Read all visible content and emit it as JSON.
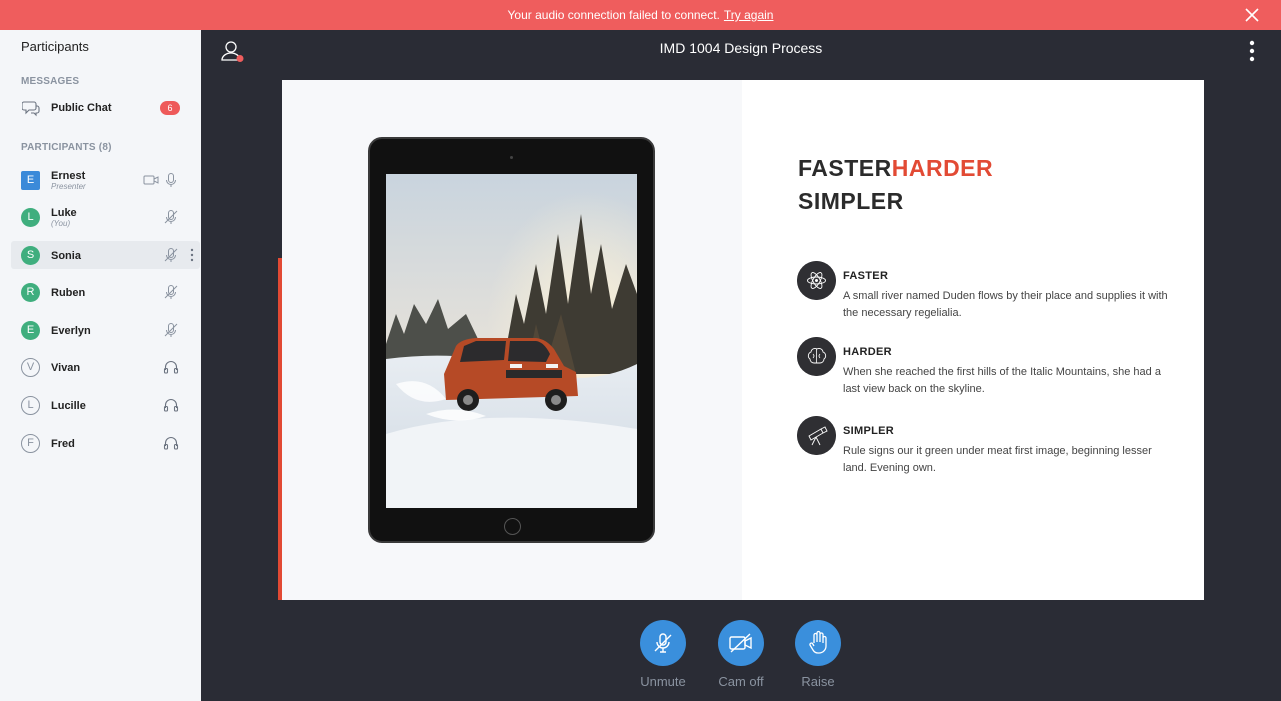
{
  "alert": {
    "message": "Your audio connection failed to connect.",
    "link": "Try again"
  },
  "sidebar": {
    "title": "Participants",
    "messages_label": "MESSAGES",
    "public_chat": {
      "label": "Public Chat",
      "unread": "6"
    },
    "participants_label": "PARTICIPANTS (8)",
    "participants": [
      {
        "initial": "E",
        "name": "Ernest",
        "role": "Presenter",
        "audio": "mic",
        "video": true
      },
      {
        "initial": "L",
        "name": "Luke",
        "role": "(You)",
        "audio": "muted"
      },
      {
        "initial": "S",
        "name": "Sonia",
        "role": "",
        "audio": "muted"
      },
      {
        "initial": "R",
        "name": "Ruben",
        "role": "",
        "audio": "muted"
      },
      {
        "initial": "E",
        "name": "Everlyn",
        "role": "",
        "audio": "muted"
      },
      {
        "initial": "V",
        "name": "Vivan",
        "role": "",
        "audio": "listen-only"
      },
      {
        "initial": "L",
        "name": "Lucille",
        "role": "",
        "audio": "listen-only"
      },
      {
        "initial": "F",
        "name": "Fred",
        "role": "",
        "audio": "listen-only"
      }
    ]
  },
  "header": {
    "meeting_title": "IMD 1004 Design Process"
  },
  "slide": {
    "headline_part1": "FASTER",
    "headline_part2": "HARDER",
    "headline_line2": "SIMPLER",
    "features": [
      {
        "title": "FASTER",
        "text": "A small river named Duden flows by their place and supplies it with the necessary regelialia.",
        "icon": "atom-icon"
      },
      {
        "title": "HARDER",
        "text": "When she reached the first hills of the Italic Mountains, she had a last view back on the skyline.",
        "icon": "brain-icon"
      },
      {
        "title": "SIMPLER",
        "text": "Rule signs our it green under meat first image, beginning lesser land. Evening own.",
        "icon": "telescope-icon"
      }
    ]
  },
  "actions": {
    "unmute": "Unmute",
    "cam_off": "Cam off",
    "raise": "Raise"
  },
  "colors": {
    "alert_bg": "#ef5d5d",
    "accent_red": "#e24a34",
    "action_blue": "#3a8fdc",
    "main_bg": "#2a2c35"
  }
}
